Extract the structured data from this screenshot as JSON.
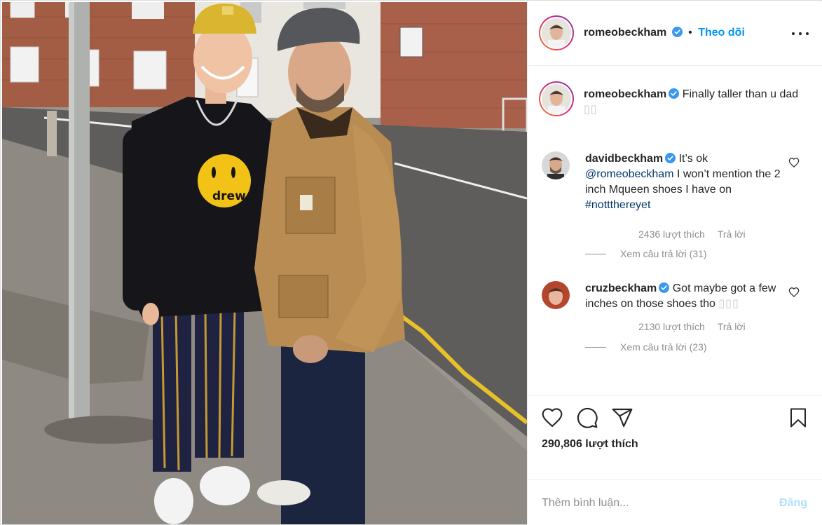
{
  "post": {
    "author": "romeobeckham",
    "separator": "•",
    "follow_label": "Theo dõi",
    "more_icon": "more-options-icon"
  },
  "caption": {
    "username": "romeobeckham",
    "text": "Finally taller than u dad",
    "emoji": "▯▯"
  },
  "comments": [
    {
      "username": "davidbeckham",
      "text_before": "It’s ok",
      "mention": "@romeobeckham",
      "text_middle": "I won’t mention the 2 inch Mqueen shoes I have on",
      "hashtag": "#nottthereyet",
      "likes": "2436 lượt thích",
      "reply_label": "Trả lời",
      "view_replies": "Xem câu trả lời (31)"
    },
    {
      "username": "cruzbeckham",
      "text": "Got maybe got a few inches on those shoes tho",
      "emoji": "▯▯▯",
      "likes": "2130 lượt thích",
      "reply_label": "Trả lời",
      "view_replies": "Xem câu trả lời (23)"
    }
  ],
  "actions": {
    "like_icon": "heart-icon",
    "comment_icon": "comment-icon",
    "share_icon": "share-icon",
    "save_icon": "bookmark-icon",
    "likes_count": "290,806 lượt thích"
  },
  "add_comment": {
    "placeholder": "Thêm bình luận...",
    "post_label": "Đăng"
  },
  "colors": {
    "accent": "#0095f6",
    "link": "#00376b",
    "muted": "#8e8e8e",
    "text": "#262626"
  }
}
